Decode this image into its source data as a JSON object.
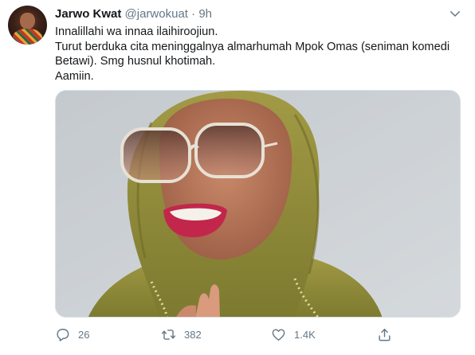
{
  "tweet": {
    "name": "Jarwo Kwat",
    "handle": "@jarwokuat",
    "separator": "·",
    "time": "9h",
    "lines": [
      "Innalillahi wa innaa ilaihiroojiun.",
      "Turut berduka cita meninggalnya almarhumah Mpok Omas (seniman komedi Betawi). Smg husnul khotimah.",
      "Aamiin."
    ]
  },
  "actions": {
    "reply_count": "26",
    "retweet_count": "382",
    "like_count": "1.4K"
  },
  "icons": {
    "avatar": "avatar-photo",
    "caret": "chevron-down-icon",
    "reply": "reply-icon",
    "retweet": "retweet-icon",
    "like": "heart-icon",
    "share": "share-icon"
  },
  "colors": {
    "text": "#14171a",
    "secondary": "#657786",
    "border": "#d8e0e6"
  }
}
